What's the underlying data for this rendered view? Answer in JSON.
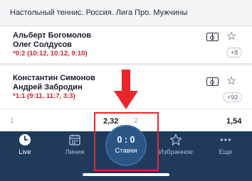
{
  "league": {
    "title": "Настольный теннис. Россия. Лига Про. Мужчины"
  },
  "matches": [
    {
      "team1": "Альберт Богомолов",
      "team2": "Олег Солдусов",
      "score": "*0:2 (10:12, 10:12, 9:10)",
      "more": "+8",
      "field_icon": "field-icon",
      "star_icon": "star-icon"
    },
    {
      "team1": "Константин Симонов",
      "team2": "Андрей Забродин",
      "score": "*1:1 (9:11, 11:7, 3:3)",
      "more": "+92",
      "field_icon": "field-icon",
      "star_icon": "star-icon"
    }
  ],
  "odds": {
    "label1": "1",
    "value1": "2,32",
    "label2": "2",
    "value2": "1,54"
  },
  "tabbar": {
    "live": "Live",
    "line": "Линия",
    "bet_score": "0 : 0",
    "bets": "Ставки",
    "favorites": "Избранное",
    "more": "Еще"
  },
  "colors": {
    "score_red": "#d21f26",
    "tabbar_bg": "#1f3a5b",
    "annotation_red": "#e8252a"
  }
}
